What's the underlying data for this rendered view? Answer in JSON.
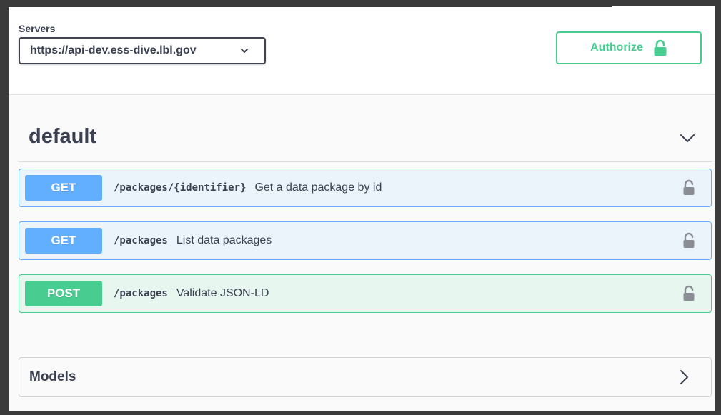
{
  "servers": {
    "label": "Servers",
    "selected": "https://api-dev.ess-dive.lbl.gov"
  },
  "authorize": {
    "label": "Authorize",
    "icon": "lock-icon"
  },
  "tag": {
    "title": "default",
    "expanded": true
  },
  "operations": [
    {
      "method": "GET",
      "path": "/packages/{identifier}",
      "summary": "Get a data package by id"
    },
    {
      "method": "GET",
      "path": "/packages",
      "summary": "List data packages"
    },
    {
      "method": "POST",
      "path": "/packages",
      "summary": "Validate JSON-LD"
    }
  ],
  "models": {
    "title": "Models",
    "expanded": false
  },
  "colors": {
    "get": "#61affe",
    "post": "#49cc90",
    "text": "#3b4151"
  }
}
